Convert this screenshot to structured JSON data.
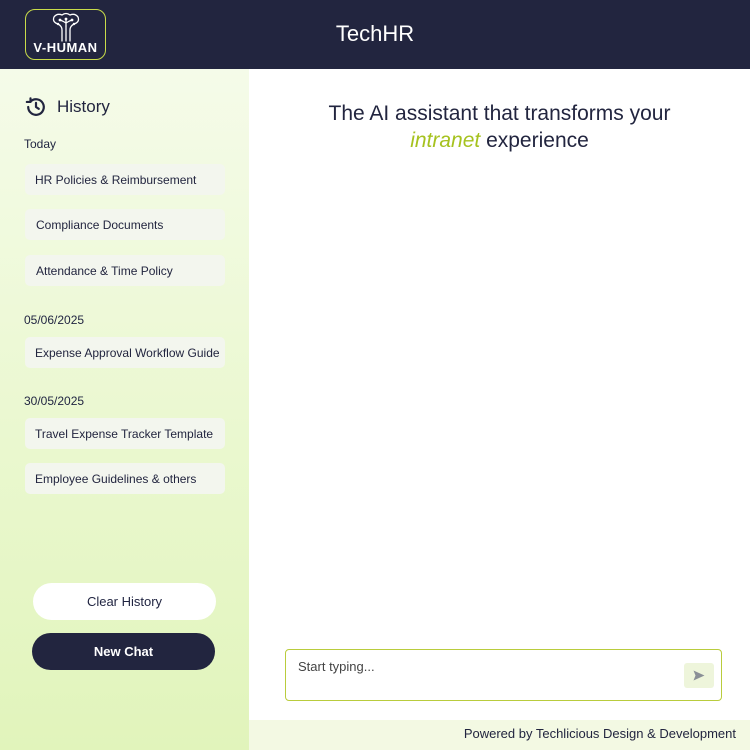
{
  "header": {
    "logo_text": "V-HUMAN",
    "title": "TechHR"
  },
  "sidebar": {
    "history_title": "History",
    "groups": [
      {
        "label": "Today",
        "items": [
          "HR Policies &  Reimbursement",
          "Compliance Documents",
          "Attendance & Time Policy"
        ]
      },
      {
        "label": "05/06/2025",
        "items": [
          "Expense Approval Workflow Guide"
        ]
      },
      {
        "label": "30/05/2025",
        "items": [
          "Travel Expense Tracker Template",
          "Employee Guidelines & others"
        ]
      }
    ],
    "clear_label": "Clear History",
    "new_chat_label": "New Chat"
  },
  "main": {
    "tagline_line1": "The AI assistant that transforms your",
    "tagline_accent": "intranet",
    "tagline_rest": " experience"
  },
  "composer": {
    "placeholder": "Start typing..."
  },
  "footer": {
    "text": "Powered by Techlicious Design & Development"
  },
  "colors": {
    "navy": "#22253f",
    "accent": "#a6c21f",
    "sidebar_bg": "#eaf8cf"
  }
}
